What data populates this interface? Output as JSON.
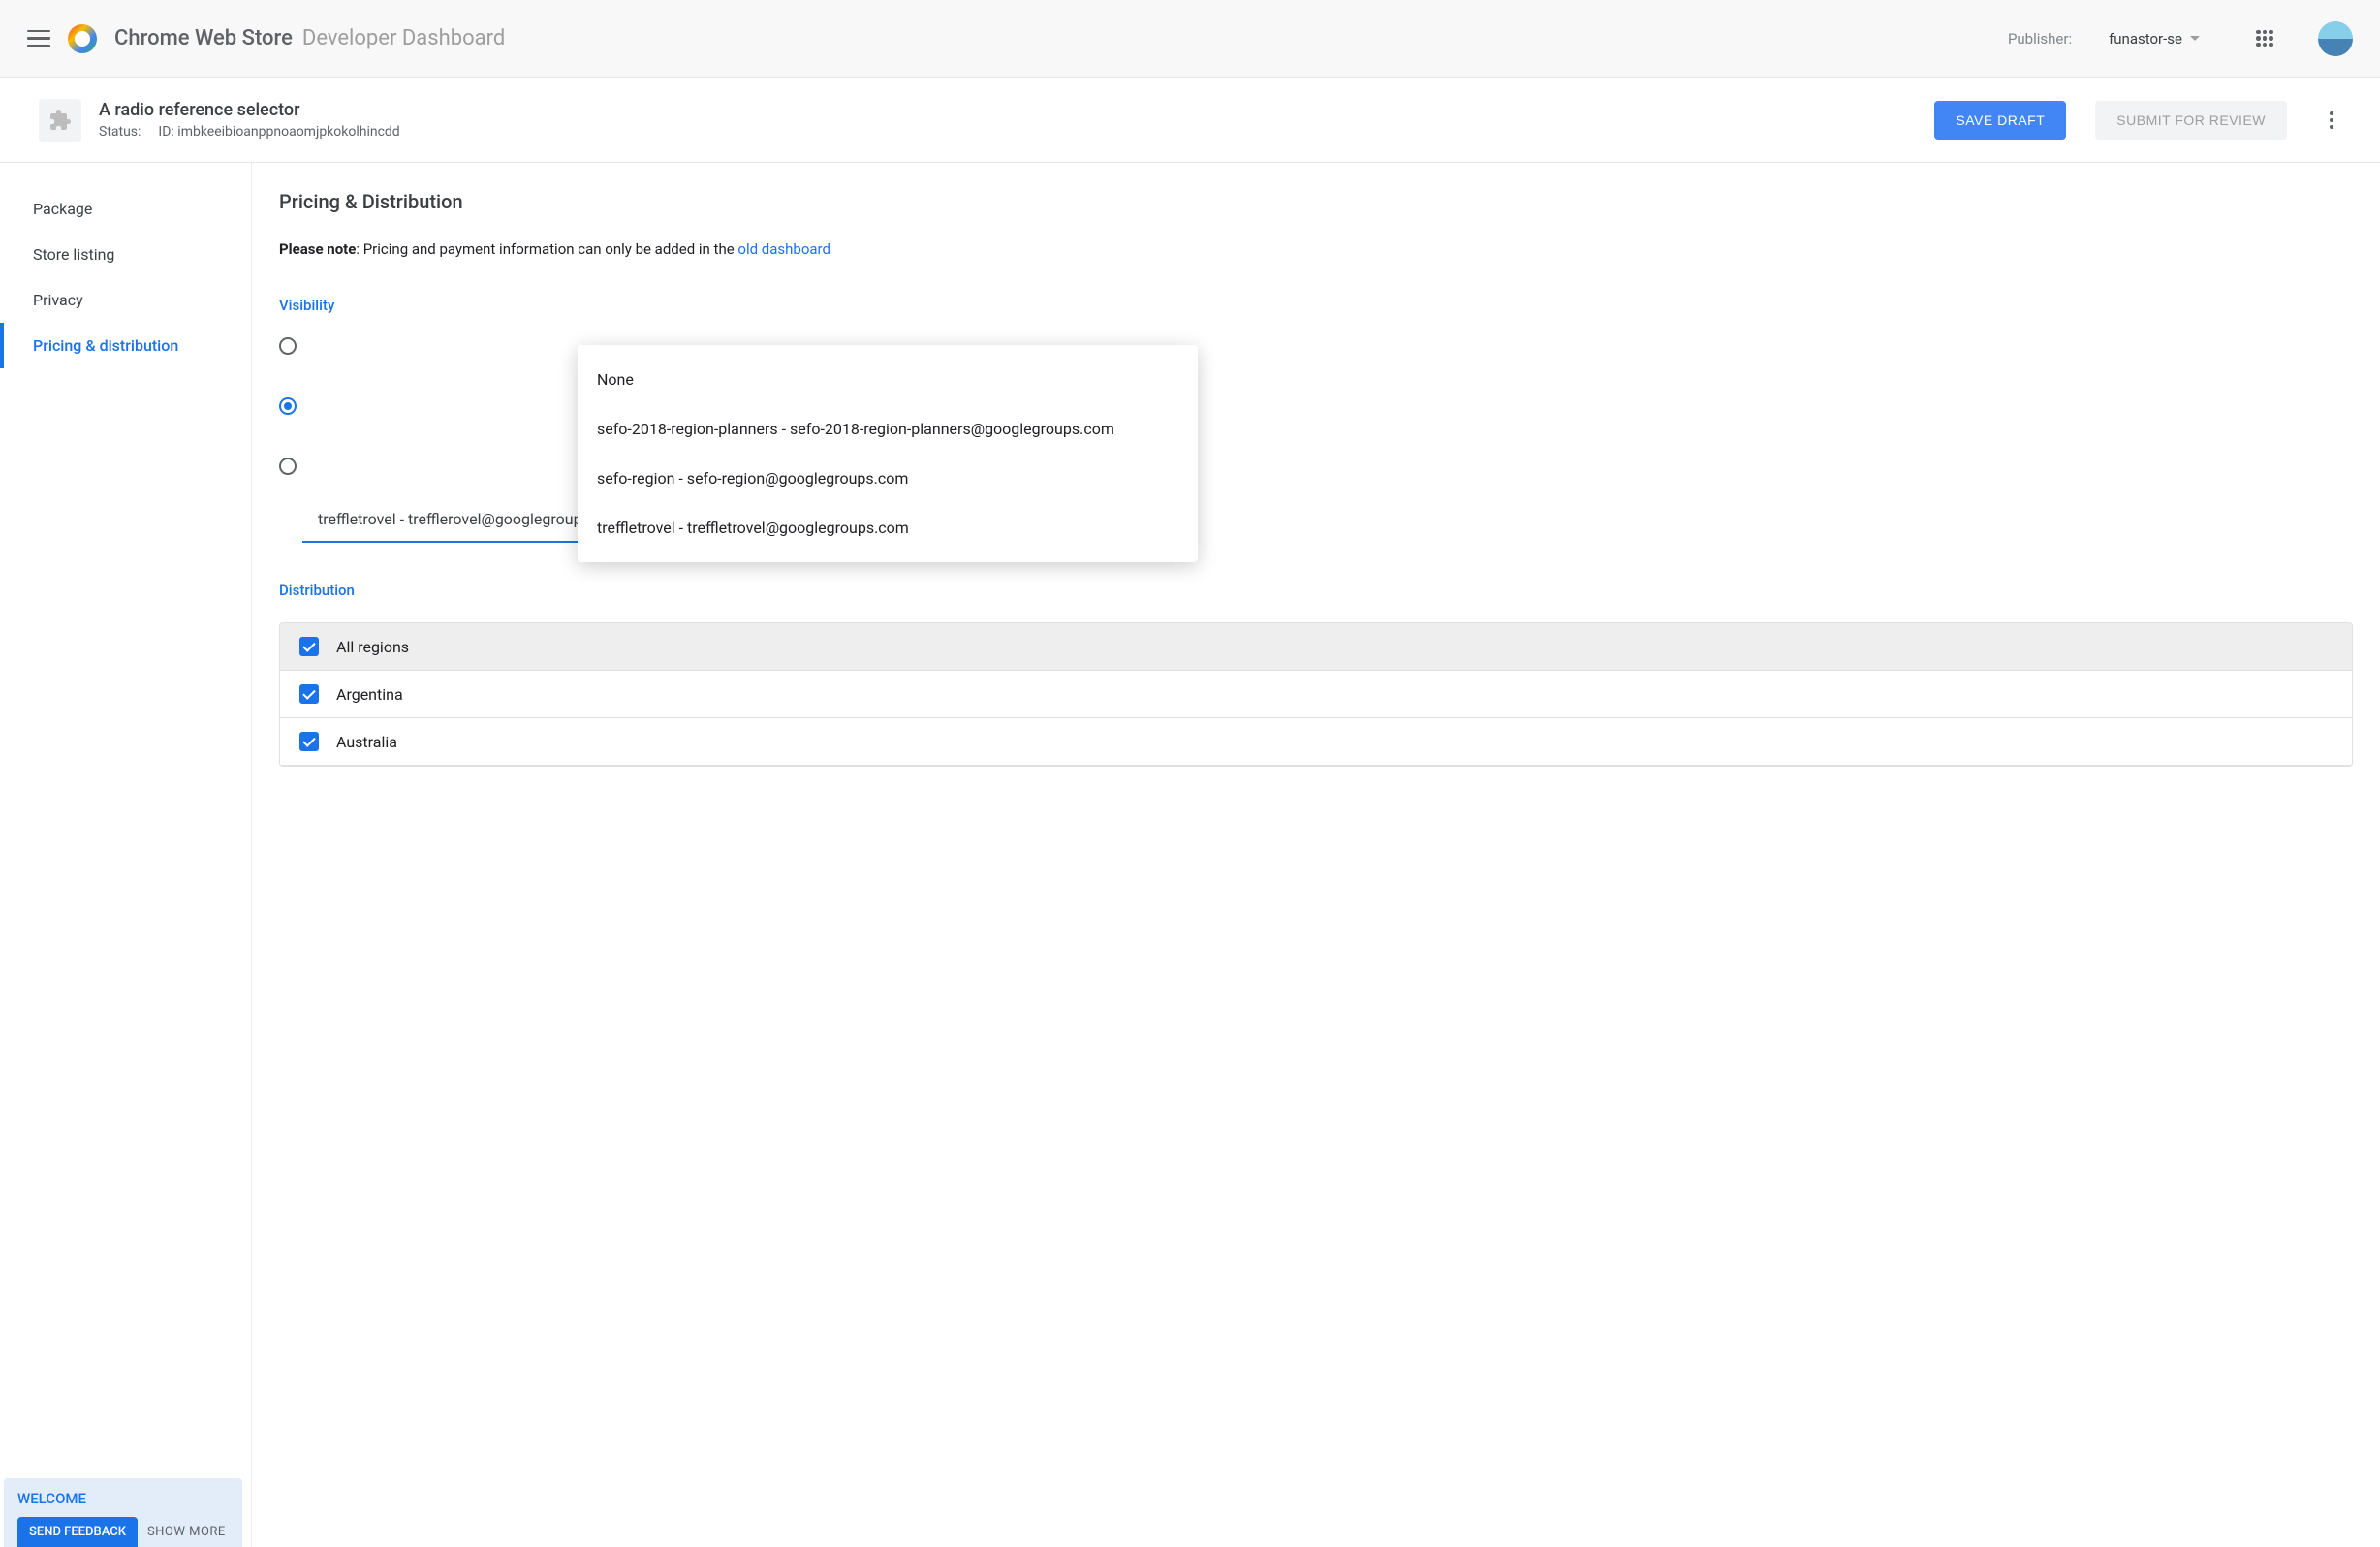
{
  "header": {
    "title_strong": "Chrome Web Store",
    "title_light": "Developer Dashboard",
    "publisher_label": "Publisher:",
    "publisher_value": "funastor-se"
  },
  "item": {
    "name": "A radio reference selector",
    "status_label": "Status:",
    "id_label": "ID:",
    "id_value": "imbkeeibioanppnoaomjpkokolhincdd",
    "save_btn": "SAVE DRAFT",
    "submit_btn": "SUBMIT FOR REVIEW"
  },
  "sidebar": {
    "items": [
      "Package",
      "Store listing",
      "Privacy",
      "Pricing & distribution"
    ],
    "active_index": 3
  },
  "content": {
    "title": "Pricing & Distribution",
    "note_bold": "Please note",
    "note_rest": ": Pricing and payment information can only be added in the ",
    "note_link": "old dashboard",
    "visibility_label": "Visibility",
    "dropdown_value": "treffletrovel - trefflerovel@googlegroups.com",
    "popup_options": [
      "None",
      "sefo-2018-region-planners - sefo-2018-region-planners@googlegroups.com",
      "sefo-region - sefo-region@googlegroups.com",
      "treffletrovel - treffletrovel@googlegroups.com"
    ],
    "distribution_label": "Distribution",
    "regions": [
      "All regions",
      "Argentina",
      "Australia"
    ]
  },
  "feedback": {
    "title": "WELCOME",
    "send": "SEND FEEDBACK",
    "more": "SHOW MORE"
  }
}
